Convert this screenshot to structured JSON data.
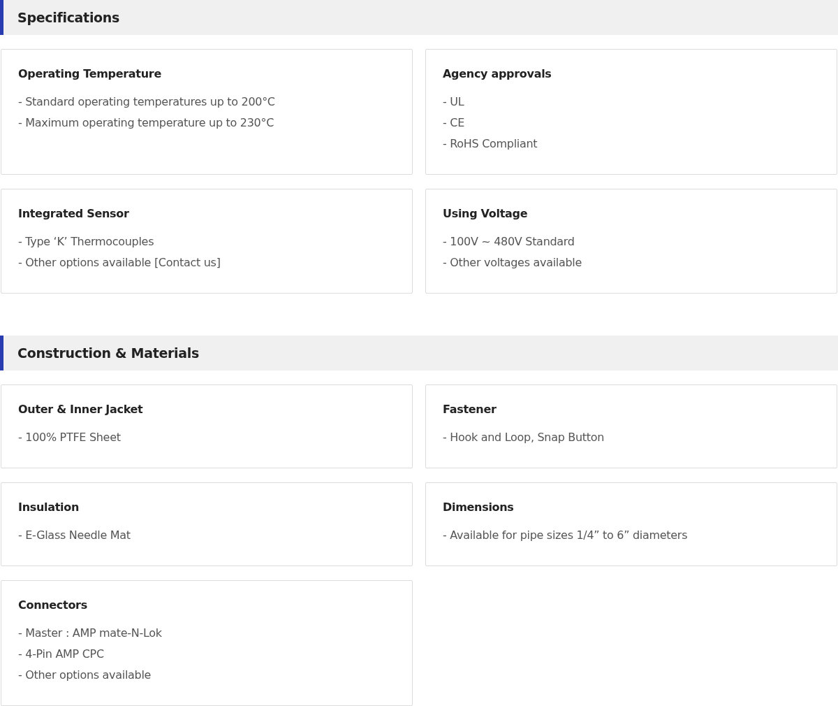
{
  "sections": [
    {
      "title": "Specifications",
      "cards": [
        {
          "title": "Operating Temperature",
          "items": [
            "- Standard operating temperatures up to 200°C",
            "- Maximum operating temperature up to 230°C"
          ]
        },
        {
          "title": "Agency approvals",
          "items": [
            "- UL",
            "- CE",
            "- RoHS Compliant"
          ]
        },
        {
          "title": "Integrated Sensor",
          "items": [
            "- Type ‘K’ Thermocouples",
            "- Other options available [Contact us]"
          ]
        },
        {
          "title": "Using Voltage",
          "items": [
            "- 100V ~ 480V Standard",
            "- Other voltages available"
          ]
        }
      ]
    },
    {
      "title": "Construction & Materials",
      "cards": [
        {
          "title": "Outer & Inner Jacket",
          "items": [
            "- 100% PTFE Sheet"
          ]
        },
        {
          "title": "Fastener",
          "items": [
            "- Hook and Loop, Snap Button"
          ]
        },
        {
          "title": "Insulation",
          "items": [
            "- E-Glass Needle Mat"
          ]
        },
        {
          "title": "Dimensions",
          "items": [
            "- Available for pipe sizes 1/4” to 6” diameters"
          ]
        },
        {
          "title": "Connectors",
          "items": [
            "- Master : AMP mate-N-Lok",
            "- 4-Pin AMP CPC",
            "- Other options available"
          ]
        }
      ]
    }
  ]
}
